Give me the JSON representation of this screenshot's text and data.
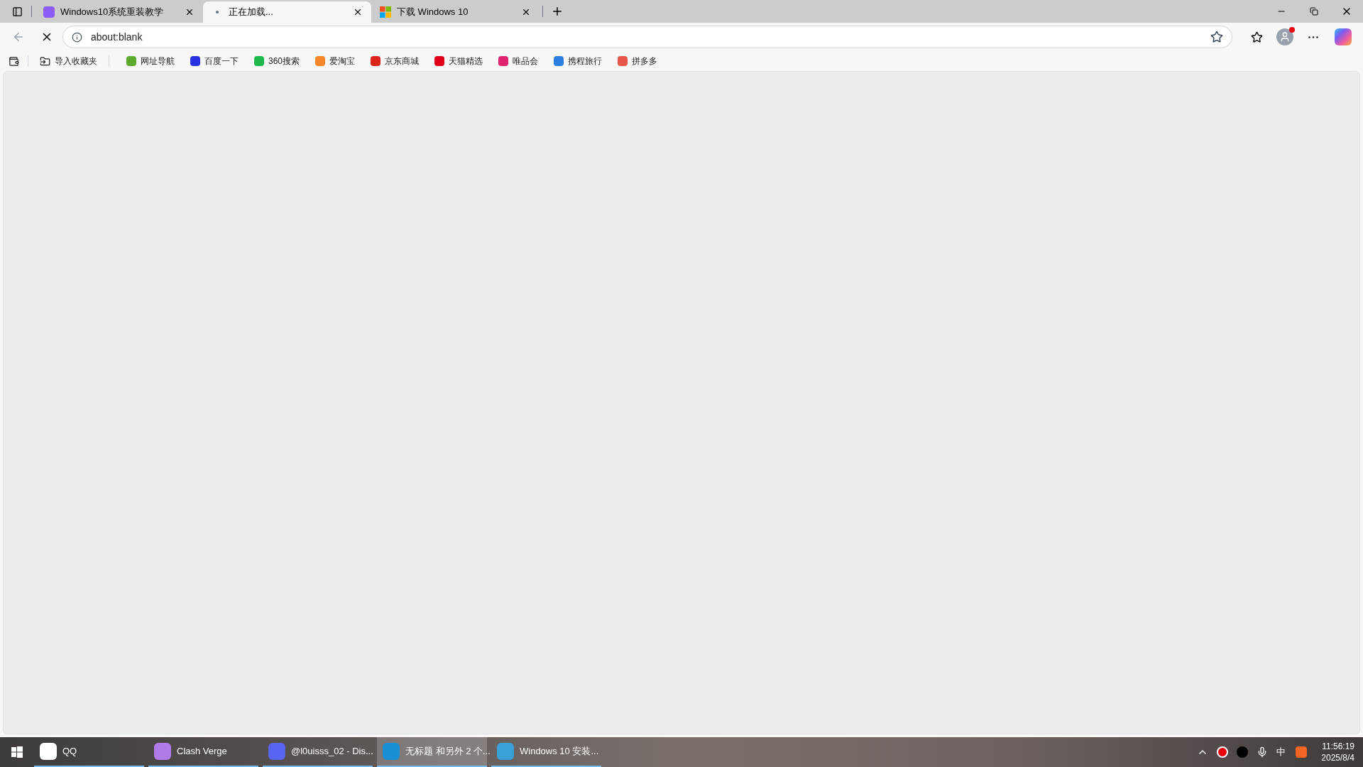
{
  "tabs": [
    {
      "title": "Windows10系统重装教学",
      "selected": false,
      "kind": "doc"
    },
    {
      "title": "正在加载...",
      "selected": true,
      "kind": "loading"
    },
    {
      "title": "下载 Windows 10",
      "selected": false,
      "kind": "windows"
    }
  ],
  "address_bar": {
    "url": "about:blank",
    "loading": true
  },
  "import_favorites": {
    "label": "导入收藏夹"
  },
  "bookmarks": [
    {
      "label": "网址导航",
      "color": "#5cab2c"
    },
    {
      "label": "百度一下",
      "color": "#2932e1"
    },
    {
      "label": "360搜索",
      "color": "#1fb84b"
    },
    {
      "label": "爱淘宝",
      "color": "#f5872b"
    },
    {
      "label": "京东商城",
      "color": "#d9251c"
    },
    {
      "label": "天猫精选",
      "color": "#e1001a"
    },
    {
      "label": "唯品会",
      "color": "#e0246e"
    },
    {
      "label": "携程旅行",
      "color": "#2b7fe0"
    },
    {
      "label": "拼多多",
      "color": "#e9574b"
    }
  ],
  "taskbar": {
    "items": [
      {
        "label": "QQ",
        "color": "#ffffff",
        "active": false
      },
      {
        "label": "Clash Verge",
        "color": "#b07ae8",
        "active": false
      },
      {
        "label": "@l0uisss_02 - Dis...",
        "color": "#5865f2",
        "active": false
      },
      {
        "label": "无标题 和另外 2 个...",
        "color": "#1b8fd6",
        "active": true
      },
      {
        "label": "Windows 10 安装...",
        "color": "#3aa0d8",
        "active": false
      }
    ],
    "ime": "中",
    "time": "11:56:19",
    "date": "2025/8/4"
  }
}
